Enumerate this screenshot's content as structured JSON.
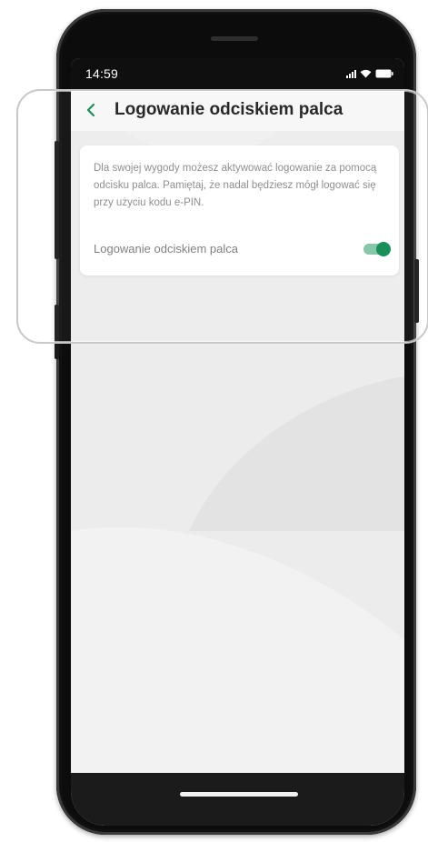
{
  "status_bar": {
    "time": "14:59"
  },
  "header": {
    "title": "Logowanie odciskiem palca",
    "back_icon": "chevron-left-icon"
  },
  "card": {
    "description": "Dla swojej wygody możesz aktywować logowanie za pomocą odcisku palca. Pamiętaj, że nadal będziesz mógł logować się przy użyciu kodu e-PIN.",
    "toggle_label": "Logowanie odciskiem palca",
    "toggle_state": "on"
  },
  "colors": {
    "accent": "#0f8a52",
    "toggle_track": "#7fc4a4",
    "back_icon": "#0f8a52"
  }
}
